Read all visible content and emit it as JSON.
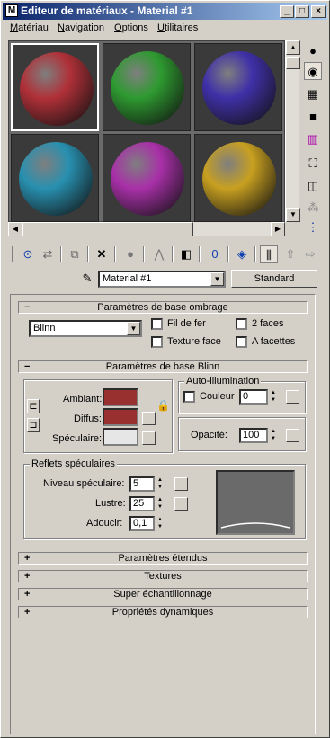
{
  "window": {
    "title": "Editeur de matériaux - Material #1",
    "icon": "app-icon"
  },
  "menu": [
    "Matériau",
    "Navigation",
    "Options",
    "Utilitaires"
  ],
  "sample_slots": [
    {
      "color": "#b03038",
      "selected": true
    },
    {
      "color": "#2e9a30",
      "selected": false
    },
    {
      "color": "#4030a8",
      "selected": false
    },
    {
      "color": "#2890b0",
      "selected": false
    },
    {
      "color": "#a830a8",
      "selected": false
    },
    {
      "color": "#c8a020",
      "selected": false
    }
  ],
  "material_name": "Material #1",
  "material_type": "Standard",
  "shader_panel": {
    "title": "Paramètres de base ombrage",
    "shader": "Blinn",
    "options": [
      "Fil de fer",
      "2 faces",
      "Texture face",
      "A facettes"
    ]
  },
  "blinn_panel": {
    "title": "Paramètres de base Blinn",
    "ambient_label": "Ambiant:",
    "diffuse_label": "Diffus:",
    "specular_label": "Spéculaire:",
    "ambient_color": "#983030",
    "diffuse_color": "#983030",
    "specular_color": "#e6e6e6",
    "self_illum_title": "Auto-illumination",
    "color_label": "Couleur",
    "self_illum_value": "0",
    "opacity_label": "Opacité:",
    "opacity_value": "100"
  },
  "specular_highlights": {
    "title": "Reflets spéculaires",
    "level_label": "Niveau spéculaire:",
    "level_value": "5",
    "gloss_label": "Lustre:",
    "gloss_value": "25",
    "soften_label": "Adoucir:",
    "soften_value": "0,1"
  },
  "collapsed_rollouts": [
    "Paramètres étendus",
    "Textures",
    "Super échantillonnage",
    "Propriétés dynamiques"
  ]
}
